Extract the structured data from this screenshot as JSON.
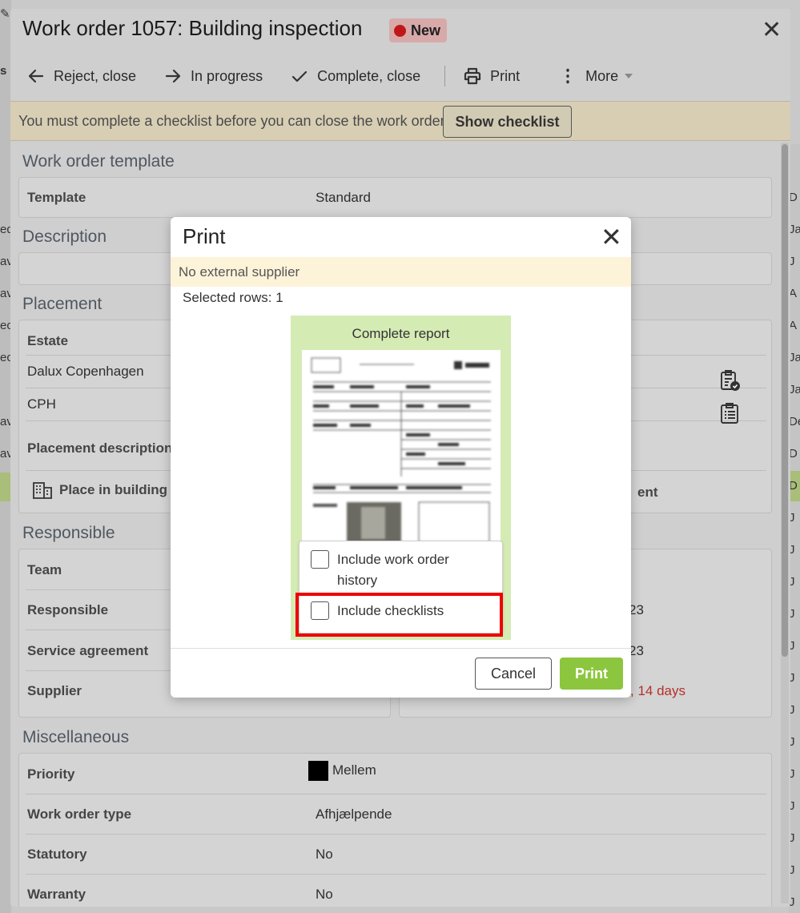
{
  "background": {
    "left_fragments": [
      "ed",
      "av",
      "av",
      "ec",
      "ec",
      "av",
      "av"
    ],
    "right_fragments": [
      "D",
      "Ja",
      "J",
      "A",
      "A",
      "Ja",
      "Ja",
      "De",
      "D",
      "D",
      "J",
      "J",
      "J",
      "J",
      "J",
      "J",
      "J",
      "J",
      "J",
      "J",
      "J",
      "J",
      "J"
    ]
  },
  "work_order": {
    "title": "Work order 1057:  Building inspection",
    "status": "New",
    "status_color": "#c01818",
    "toolbar": {
      "reject": "Reject, close",
      "in_progress": "In progress",
      "complete": "Complete, close",
      "print": "Print",
      "more": "More"
    },
    "notice": {
      "text": "You must complete a checklist before you can close the work order",
      "button": "Show checklist"
    },
    "template_section": {
      "title": "Work order template",
      "label": "Template",
      "value": "Standard"
    },
    "description_section": {
      "title": "Description"
    },
    "placement_section": {
      "title": "Placement",
      "estate_label": "Estate",
      "estate_value": "Dalux Copenhagen",
      "building_value": "CPH",
      "placement_description_label": "Placement description",
      "place_in_building": "Place in building",
      "right_fragment": "ent"
    },
    "responsible_section": {
      "title": "Responsible",
      "team_label": "Team",
      "responsible_label": "Responsible",
      "service_label": "Service agreement",
      "supplier_label": "Supplier",
      "right_values": [
        "23",
        "23",
        ", 14 days"
      ]
    },
    "misc_section": {
      "title": "Miscellaneous",
      "priority_label": "Priority",
      "priority_value": "Mellem",
      "priority_color": "#000000",
      "type_label": "Work order type",
      "type_value": "Afhjælpende",
      "statutory_label": "Statutory",
      "statutory_value": "No",
      "warranty_label": "Warranty",
      "warranty_value": "No"
    }
  },
  "print_dialog": {
    "title": "Print",
    "warning": "No external supplier",
    "selected_rows": "Selected rows: 1",
    "report_title": "Complete report",
    "options": {
      "history": "Include work order history",
      "checklists": "Include checklists"
    },
    "cancel": "Cancel",
    "print": "Print"
  }
}
